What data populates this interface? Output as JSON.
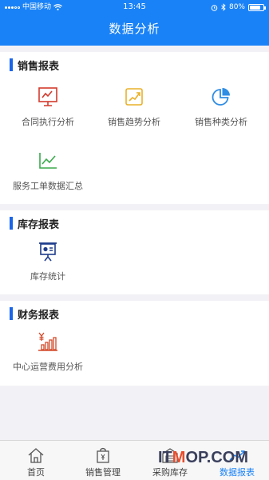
{
  "status_bar": {
    "carrier": "中国移动",
    "time": "13:45",
    "battery": "80%",
    "battery_level": 0.8
  },
  "header": {
    "title": "数据分析"
  },
  "sections": [
    {
      "title": "销售报表",
      "items": [
        {
          "label": "合同执行分析",
          "icon": "contract-chart-icon",
          "color": "#d33a2c"
        },
        {
          "label": "销售趋势分析",
          "icon": "trend-chart-icon",
          "color": "#e9b12a"
        },
        {
          "label": "销售种类分析",
          "icon": "pie-chart-icon",
          "color": "#2f8de4"
        },
        {
          "label": "服务工单数据汇总",
          "icon": "line-chart-icon",
          "color": "#3aaa4c"
        }
      ]
    },
    {
      "title": "库存报表",
      "items": [
        {
          "label": "库存统计",
          "icon": "presentation-board-icon",
          "color": "#1e3c8c"
        }
      ]
    },
    {
      "title": "财务报表",
      "items": [
        {
          "label": "中心运营费用分析",
          "icon": "yuan-bar-chart-icon",
          "color": "#d34a2a"
        }
      ]
    }
  ],
  "tabbar": {
    "tabs": [
      {
        "label": "首页",
        "icon": "home-icon",
        "active": false
      },
      {
        "label": "销售管理",
        "icon": "shopping-bag-icon",
        "active": false
      },
      {
        "label": "采购库存",
        "icon": "warehouse-icon",
        "active": false
      },
      {
        "label": "数据报表",
        "icon": "report-chart-icon",
        "active": true
      }
    ]
  },
  "watermark": {
    "prefix": "IT",
    "highlight": "M",
    "suffix": "OP.COM"
  }
}
